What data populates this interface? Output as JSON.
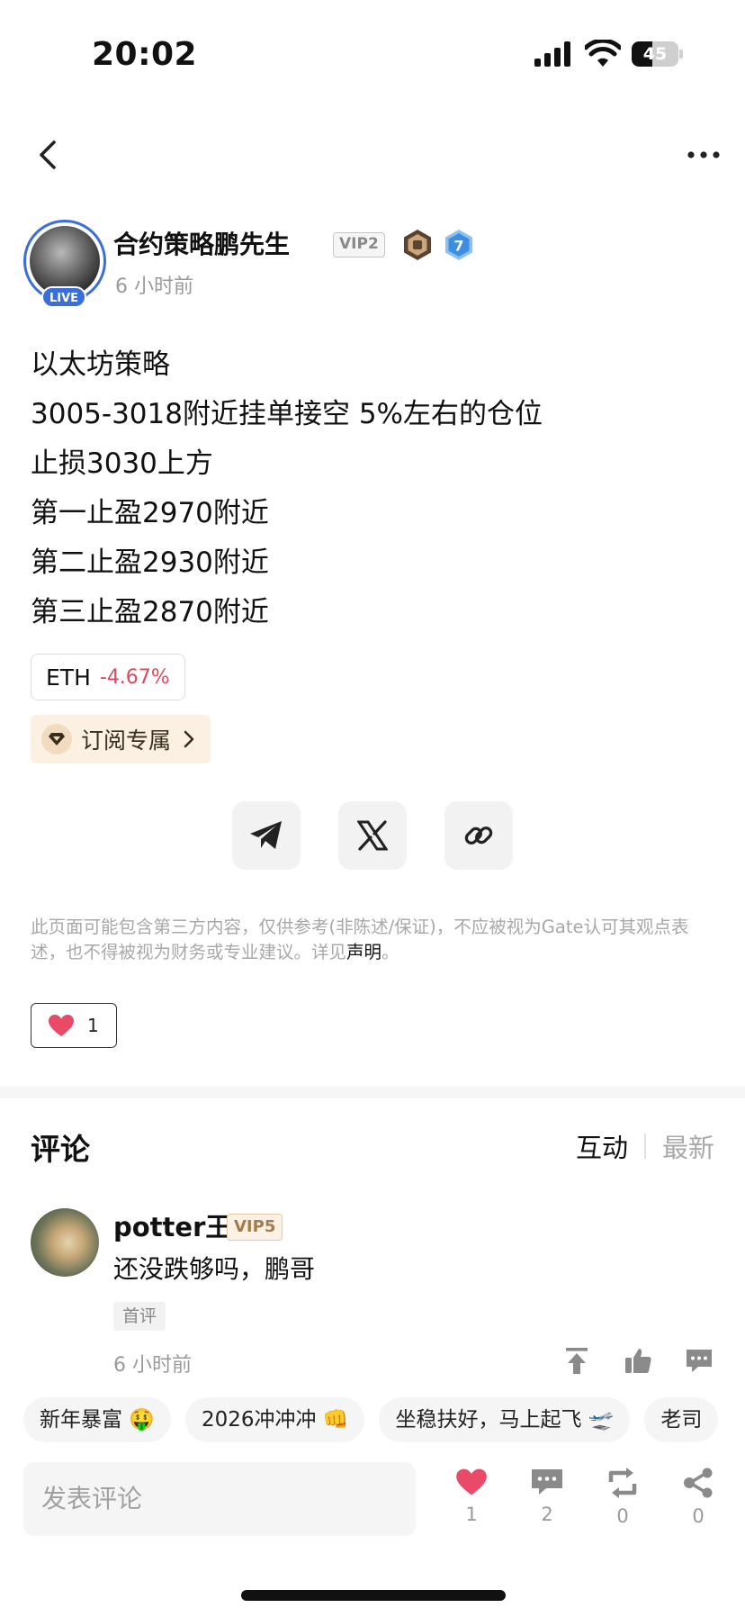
{
  "status_bar": {
    "time": "20:02",
    "battery": "45",
    "battery_level": 0.45
  },
  "post": {
    "author": "合约策略鹏先生",
    "live_label": "LIVE",
    "vip": "VIP2",
    "level": "7",
    "time": "6 小时前",
    "lines": [
      "以太坊策略",
      "3005-3018附近挂单接空 5%左右的仓位",
      "止损3030上方",
      "第一止盈2970附近",
      "第二止盈2930附近",
      "第三止盈2870附近"
    ],
    "ticker": {
      "symbol": "ETH",
      "change": "-4.67%",
      "change_color": "#e2475c"
    },
    "subscribe_label": "订阅专属",
    "disclaimer": "此页面可能包含第三方内容，仅供参考(非陈述/保证)，不应被视为Gate认可其观点表述，也不得被视为财务或专业建议。详见",
    "disclaimer_link": "声明",
    "disclaimer_end": "。",
    "likes": "1"
  },
  "comments": {
    "title": "评论",
    "sort_active": "互动",
    "sort_inactive": "最新",
    "items": [
      {
        "user": "potter王",
        "vip": "VIP5",
        "text": "还没跌够吗，鹏哥",
        "tag": "首评",
        "time": "6 小时前"
      }
    ]
  },
  "quick_replies": [
    "新年暴富 🤑",
    "2026冲冲冲 👊",
    "坐稳扶好，马上起飞 🛫",
    "老司"
  ],
  "bottom_bar": {
    "placeholder": "发表评论",
    "likes": "1",
    "comments": "2",
    "reposts": "0",
    "shares": "0"
  },
  "colors": {
    "accent_blue": "#3a6ed8",
    "like_red": "#e84a68",
    "negative": "#e2475c"
  }
}
